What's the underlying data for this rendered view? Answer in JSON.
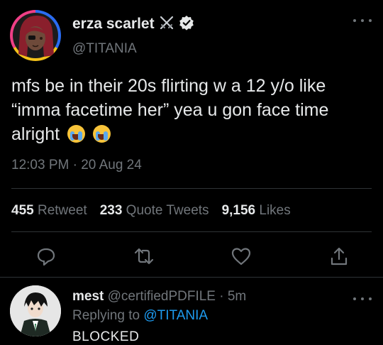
{
  "tweet": {
    "author": {
      "display_name": "erza scarlet",
      "handle": "@TITANIA",
      "emoji_icon": "crossed-swords-icon",
      "verified_icon": "verified-badge-icon"
    },
    "text_line1": "mfs be in their 20s flirting w a 12 y/o like",
    "text_line2": "“imma facetime her” yea u gon face time",
    "text_line3": "alright",
    "emojis": [
      "loudly-crying-face-icon",
      "loudly-crying-face-icon"
    ],
    "timestamp": "12:03 PM · 20 Aug 24",
    "stats": {
      "retweets_count": "455",
      "retweets_label": "Retweet",
      "quotes_count": "233",
      "quotes_label": "Quote Tweets",
      "likes_count": "9,156",
      "likes_label": "Likes"
    },
    "actions": [
      "reply-icon",
      "retweet-icon",
      "like-icon",
      "share-icon"
    ]
  },
  "reply": {
    "display_name": "mest",
    "handle_time": "@certifiedPDFILE · 5m",
    "replying_prefix": "Replying to",
    "replying_to": "@TITANIA",
    "text": "BLOCKED"
  },
  "colors": {
    "background": "#000000",
    "text": "#e7e9ea",
    "secondary": "#71767b",
    "link": "#1d9bf0",
    "divider": "#2f3336"
  }
}
